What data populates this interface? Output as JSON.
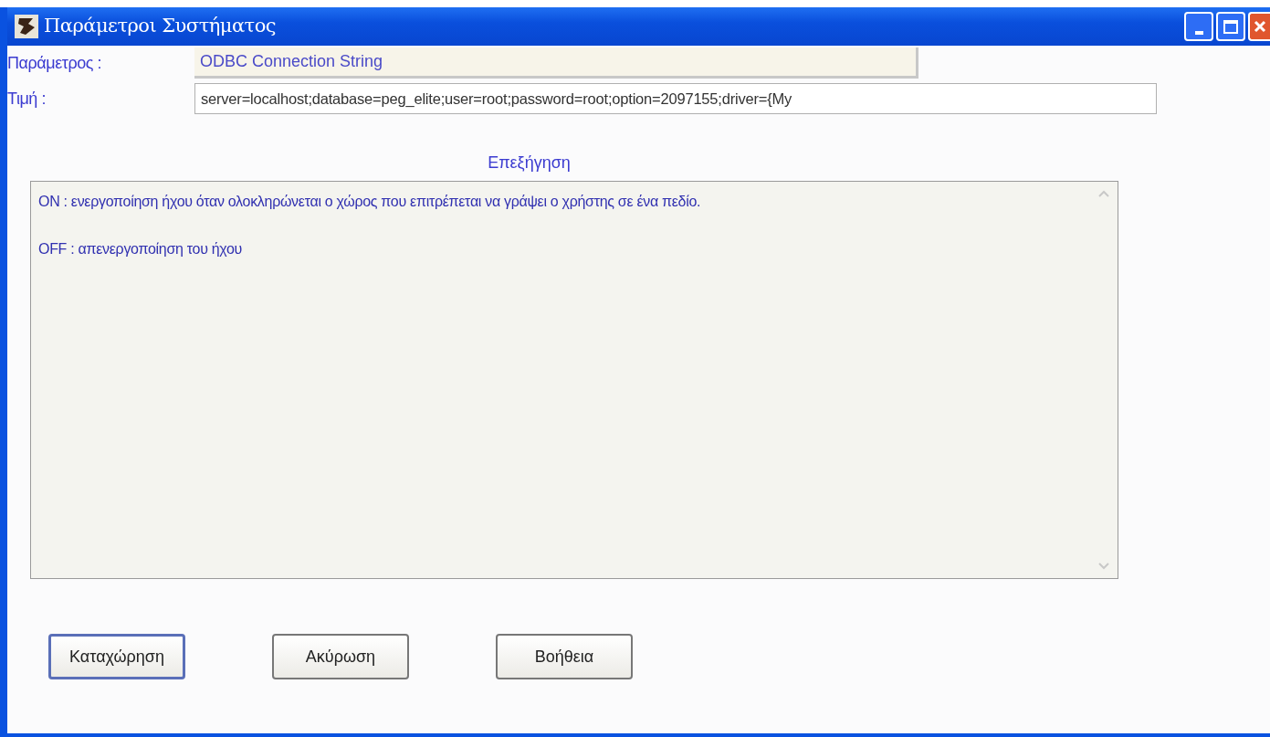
{
  "window": {
    "title": "Παράμετροι Συστήματος"
  },
  "fields": [
    {
      "label": "Παράμετρος :",
      "value": "ODBC Connection String",
      "kind": "readonly"
    },
    {
      "label": "Τιμή :",
      "value": "server=localhost;database=peg_elite;user=root;password=root;option=2097155;driver={My",
      "kind": "editable"
    }
  ],
  "explanation": {
    "heading": "Επεξήγηση",
    "lines": [
      "ON : ενεργοποίηση ήχου όταν ολοκληρώνεται ο χώρος που επιτρέπεται να γράψει ο χρήστης σε ένα πεδίο.",
      "OFF : απενεργοποίηση του ήχου"
    ]
  },
  "buttons": [
    {
      "label": "Καταχώρηση",
      "default": true
    },
    {
      "label": "Ακύρωση",
      "default": false
    },
    {
      "label": "Βοήθεια",
      "default": false
    }
  ]
}
